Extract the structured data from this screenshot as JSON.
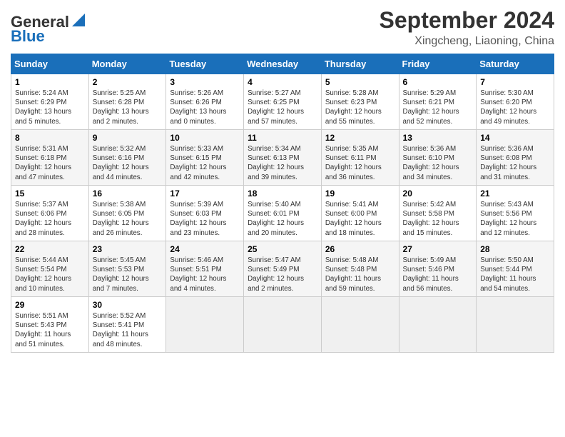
{
  "header": {
    "logo_line1": "General",
    "logo_line2": "Blue",
    "title": "September 2024",
    "subtitle": "Xingcheng, Liaoning, China"
  },
  "calendar": {
    "days_of_week": [
      "Sunday",
      "Monday",
      "Tuesday",
      "Wednesday",
      "Thursday",
      "Friday",
      "Saturday"
    ],
    "weeks": [
      [
        {
          "day": "1",
          "info": "Sunrise: 5:24 AM\nSunset: 6:29 PM\nDaylight: 13 hours\nand 5 minutes."
        },
        {
          "day": "2",
          "info": "Sunrise: 5:25 AM\nSunset: 6:28 PM\nDaylight: 13 hours\nand 2 minutes."
        },
        {
          "day": "3",
          "info": "Sunrise: 5:26 AM\nSunset: 6:26 PM\nDaylight: 13 hours\nand 0 minutes."
        },
        {
          "day": "4",
          "info": "Sunrise: 5:27 AM\nSunset: 6:25 PM\nDaylight: 12 hours\nand 57 minutes."
        },
        {
          "day": "5",
          "info": "Sunrise: 5:28 AM\nSunset: 6:23 PM\nDaylight: 12 hours\nand 55 minutes."
        },
        {
          "day": "6",
          "info": "Sunrise: 5:29 AM\nSunset: 6:21 PM\nDaylight: 12 hours\nand 52 minutes."
        },
        {
          "day": "7",
          "info": "Sunrise: 5:30 AM\nSunset: 6:20 PM\nDaylight: 12 hours\nand 49 minutes."
        }
      ],
      [
        {
          "day": "8",
          "info": "Sunrise: 5:31 AM\nSunset: 6:18 PM\nDaylight: 12 hours\nand 47 minutes."
        },
        {
          "day": "9",
          "info": "Sunrise: 5:32 AM\nSunset: 6:16 PM\nDaylight: 12 hours\nand 44 minutes."
        },
        {
          "day": "10",
          "info": "Sunrise: 5:33 AM\nSunset: 6:15 PM\nDaylight: 12 hours\nand 42 minutes."
        },
        {
          "day": "11",
          "info": "Sunrise: 5:34 AM\nSunset: 6:13 PM\nDaylight: 12 hours\nand 39 minutes."
        },
        {
          "day": "12",
          "info": "Sunrise: 5:35 AM\nSunset: 6:11 PM\nDaylight: 12 hours\nand 36 minutes."
        },
        {
          "day": "13",
          "info": "Sunrise: 5:36 AM\nSunset: 6:10 PM\nDaylight: 12 hours\nand 34 minutes."
        },
        {
          "day": "14",
          "info": "Sunrise: 5:36 AM\nSunset: 6:08 PM\nDaylight: 12 hours\nand 31 minutes."
        }
      ],
      [
        {
          "day": "15",
          "info": "Sunrise: 5:37 AM\nSunset: 6:06 PM\nDaylight: 12 hours\nand 28 minutes."
        },
        {
          "day": "16",
          "info": "Sunrise: 5:38 AM\nSunset: 6:05 PM\nDaylight: 12 hours\nand 26 minutes."
        },
        {
          "day": "17",
          "info": "Sunrise: 5:39 AM\nSunset: 6:03 PM\nDaylight: 12 hours\nand 23 minutes."
        },
        {
          "day": "18",
          "info": "Sunrise: 5:40 AM\nSunset: 6:01 PM\nDaylight: 12 hours\nand 20 minutes."
        },
        {
          "day": "19",
          "info": "Sunrise: 5:41 AM\nSunset: 6:00 PM\nDaylight: 12 hours\nand 18 minutes."
        },
        {
          "day": "20",
          "info": "Sunrise: 5:42 AM\nSunset: 5:58 PM\nDaylight: 12 hours\nand 15 minutes."
        },
        {
          "day": "21",
          "info": "Sunrise: 5:43 AM\nSunset: 5:56 PM\nDaylight: 12 hours\nand 12 minutes."
        }
      ],
      [
        {
          "day": "22",
          "info": "Sunrise: 5:44 AM\nSunset: 5:54 PM\nDaylight: 12 hours\nand 10 minutes."
        },
        {
          "day": "23",
          "info": "Sunrise: 5:45 AM\nSunset: 5:53 PM\nDaylight: 12 hours\nand 7 minutes."
        },
        {
          "day": "24",
          "info": "Sunrise: 5:46 AM\nSunset: 5:51 PM\nDaylight: 12 hours\nand 4 minutes."
        },
        {
          "day": "25",
          "info": "Sunrise: 5:47 AM\nSunset: 5:49 PM\nDaylight: 12 hours\nand 2 minutes."
        },
        {
          "day": "26",
          "info": "Sunrise: 5:48 AM\nSunset: 5:48 PM\nDaylight: 11 hours\nand 59 minutes."
        },
        {
          "day": "27",
          "info": "Sunrise: 5:49 AM\nSunset: 5:46 PM\nDaylight: 11 hours\nand 56 minutes."
        },
        {
          "day": "28",
          "info": "Sunrise: 5:50 AM\nSunset: 5:44 PM\nDaylight: 11 hours\nand 54 minutes."
        }
      ],
      [
        {
          "day": "29",
          "info": "Sunrise: 5:51 AM\nSunset: 5:43 PM\nDaylight: 11 hours\nand 51 minutes."
        },
        {
          "day": "30",
          "info": "Sunrise: 5:52 AM\nSunset: 5:41 PM\nDaylight: 11 hours\nand 48 minutes."
        },
        {
          "day": "",
          "info": ""
        },
        {
          "day": "",
          "info": ""
        },
        {
          "day": "",
          "info": ""
        },
        {
          "day": "",
          "info": ""
        },
        {
          "day": "",
          "info": ""
        }
      ]
    ]
  }
}
